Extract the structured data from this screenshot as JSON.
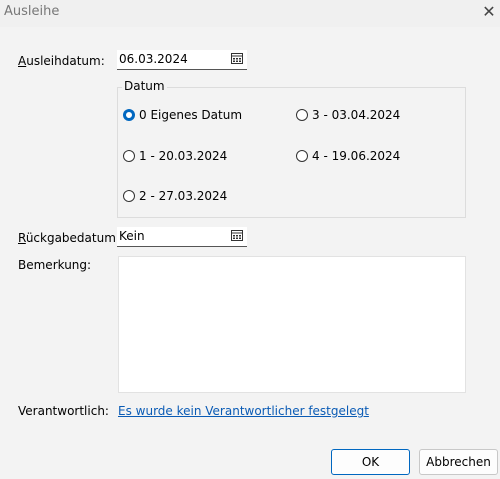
{
  "window": {
    "title": "Ausleihe",
    "close_icon": "close-icon"
  },
  "fields": {
    "ausleihdatum": {
      "label": "Ausleihdatum:",
      "value": "06.03.2024"
    },
    "rueckgabedatum": {
      "label": "Rückgabedatum:",
      "value": "Kein"
    },
    "bemerkung": {
      "label": "Bemerkung:",
      "value": ""
    },
    "verantwortlich": {
      "label": "Verantwortlich:",
      "link": "Es wurde kein Verantwortlicher festgelegt"
    }
  },
  "datum_group": {
    "legend": "Datum",
    "options": [
      {
        "label": "0 Eigenes Datum",
        "selected": true
      },
      {
        "label": "1 - 20.03.2024",
        "selected": false
      },
      {
        "label": "2 - 27.03.2024",
        "selected": false
      },
      {
        "label": "3 - 03.04.2024",
        "selected": false
      },
      {
        "label": "4 - 19.06.2024",
        "selected": false
      }
    ]
  },
  "buttons": {
    "ok": "OK",
    "cancel": "Abbrechen"
  },
  "colors": {
    "accent": "#0067c0",
    "link": "#0a5bb5"
  }
}
